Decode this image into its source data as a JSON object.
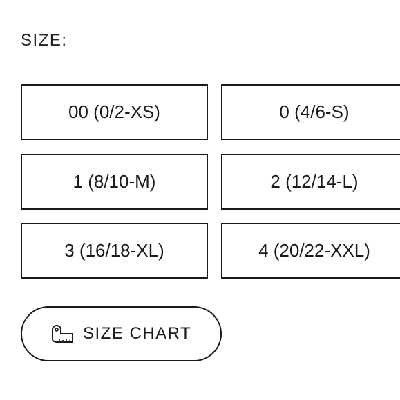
{
  "size_selector": {
    "label": "SIZE:",
    "options": [
      {
        "label": "00 (0/2-XS)"
      },
      {
        "label": "0 (4/6-S)"
      },
      {
        "label": "1 (8/10-M)"
      },
      {
        "label": "2 (12/14-L)"
      },
      {
        "label": "3 (16/18-XL)"
      },
      {
        "label": "4 (20/22-XXL)"
      }
    ]
  },
  "size_chart": {
    "label": "SIZE CHART",
    "icon": "measuring-tape-icon"
  },
  "colors": {
    "border": "#1a1a1a",
    "background": "#ffffff",
    "divider": "#d9d9d9"
  }
}
